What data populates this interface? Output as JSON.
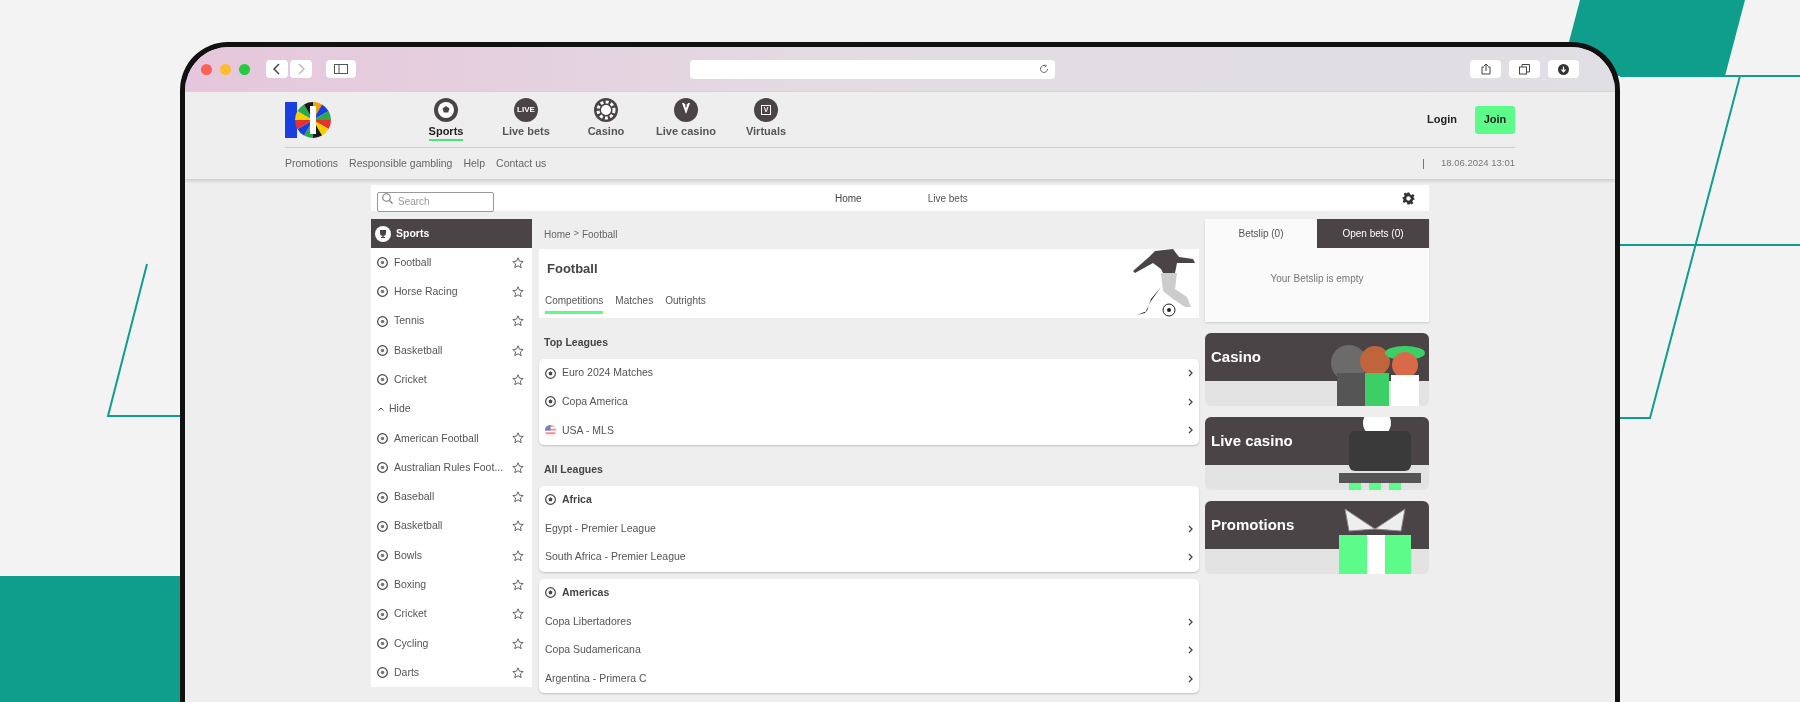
{
  "header": {
    "nav": [
      {
        "label": "Sports",
        "selected": true
      },
      {
        "label": "Live bets",
        "selected": false
      },
      {
        "label": "Casino",
        "selected": false
      },
      {
        "label": "Live casino",
        "selected": false
      },
      {
        "label": "Virtuals",
        "selected": false
      }
    ],
    "live_icon_text": "LIVE",
    "virtuals_icon_text": "V",
    "login": "Login",
    "join": "Join",
    "links": [
      "Promotions",
      "Responsible gambling",
      "Help",
      "Contact us"
    ],
    "datetime": "18.06.2024 13:01"
  },
  "toolbar": {
    "search_placeholder": "Search",
    "links": [
      "Home",
      "Live bets"
    ]
  },
  "sidebar": {
    "title": "Sports",
    "items": [
      {
        "kind": "sport",
        "label": "Football"
      },
      {
        "kind": "sport",
        "label": "Horse Racing"
      },
      {
        "kind": "sport",
        "label": "Tennis"
      },
      {
        "kind": "sport",
        "label": "Basketball"
      },
      {
        "kind": "sport",
        "label": "Cricket"
      },
      {
        "kind": "toggle",
        "label": "Hide",
        "expanded": true
      },
      {
        "kind": "sport",
        "label": "American Football"
      },
      {
        "kind": "sport",
        "label": "Australian Rules Foot..."
      },
      {
        "kind": "sport",
        "label": "Baseball"
      },
      {
        "kind": "sport",
        "label": "Basketball"
      },
      {
        "kind": "sport",
        "label": "Bowls"
      },
      {
        "kind": "sport",
        "label": "Boxing"
      },
      {
        "kind": "sport",
        "label": "Cricket"
      },
      {
        "kind": "sport",
        "label": "Cycling"
      },
      {
        "kind": "sport",
        "label": "Darts"
      }
    ]
  },
  "main": {
    "breadcrumb": [
      "Home",
      "Football"
    ],
    "breadcrumb_separator": ">",
    "title": "Football",
    "tabs": [
      {
        "label": "Competitions",
        "selected": true
      },
      {
        "label": "Matches",
        "selected": false
      },
      {
        "label": "Outrights",
        "selected": false
      }
    ],
    "top_leagues": {
      "heading": "Top Leagues",
      "items": [
        {
          "label": "Euro 2024 Matches",
          "kind": "competition"
        },
        {
          "label": "Copa America",
          "kind": "competition"
        },
        {
          "label": "USA - MLS",
          "kind": "country"
        }
      ]
    },
    "all_leagues": {
      "heading": "All Leagues",
      "groups": [
        {
          "name": "Africa",
          "items": [
            "Egypt - Premier League",
            "South Africa - Premier League"
          ]
        },
        {
          "name": "Americas",
          "items": [
            "Copa Libertadores",
            "Copa Sudamericana",
            "Argentina - Primera C"
          ]
        }
      ]
    }
  },
  "betslip": {
    "tabs": [
      {
        "label": "Betslip (0)",
        "selected": true
      },
      {
        "label": "Open bets (0)",
        "selected": false
      }
    ],
    "empty_text": "Your Betslip is empty"
  },
  "promos": [
    "Casino",
    "Live casino",
    "Promotions"
  ]
}
